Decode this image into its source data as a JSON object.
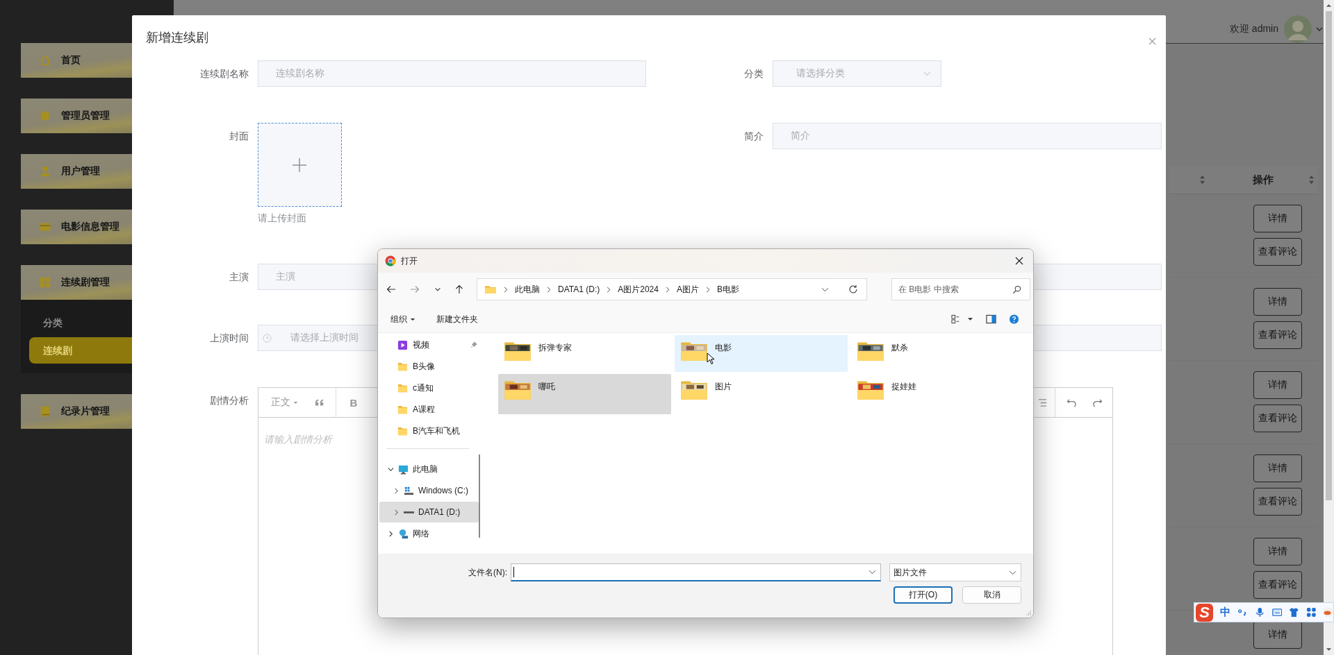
{
  "sidebar": {
    "items": [
      {
        "label": "首页"
      },
      {
        "label": "管理员管理"
      },
      {
        "label": "用户管理"
      },
      {
        "label": "电影信息管理"
      },
      {
        "label": "连续剧管理",
        "children": [
          {
            "label": "分类",
            "selected": false
          },
          {
            "label": "连续剧",
            "selected": true
          }
        ]
      },
      {
        "label": "纪录片管理"
      }
    ]
  },
  "header": {
    "greeting": "欢迎 admin"
  },
  "table": {
    "action_column": "操作",
    "rows": [
      {
        "actions": [
          "详情",
          "查看评论"
        ]
      },
      {
        "actions": [
          "详情",
          "查看评论"
        ]
      },
      {
        "actions": [
          "详情",
          "查看评论"
        ]
      },
      {
        "actions": [
          "详情",
          "查看评论"
        ]
      },
      {
        "actions": [
          "详情",
          "查看评论"
        ]
      },
      {
        "actions": [
          "详情"
        ]
      }
    ]
  },
  "modal": {
    "title": "新增连续剧",
    "rows": [
      {
        "left": {
          "kind": "text",
          "label": "连续剧名称",
          "placeholder": "连续剧名称"
        },
        "right": {
          "kind": "select",
          "label": "分类",
          "placeholder": "请选择分类"
        }
      },
      {
        "left": {
          "kind": "upload",
          "label": "封面",
          "hint": "请上传封面"
        },
        "right": {
          "kind": "text",
          "label": "简介",
          "placeholder": "简介"
        }
      },
      {
        "left": {
          "kind": "text",
          "label": "主演",
          "placeholder": "主演"
        },
        "right": {
          "kind": "text"
        }
      },
      {
        "left": {
          "kind": "date",
          "label": "上演时间",
          "placeholder": "请选择上演时间"
        },
        "right": {
          "kind": "text"
        }
      }
    ],
    "editor": {
      "label": "剧情分析",
      "format": "正文",
      "bold": "B",
      "placeholder": "请输入剧情分析"
    }
  },
  "dialog": {
    "title": "打开",
    "path": [
      "此电脑",
      "DATA1 (D:)",
      "A图片2024",
      "A图片",
      "B电影"
    ],
    "search_placeholder": "在 B电影 中搜索",
    "commands": [
      "组织",
      "新建文件夹"
    ],
    "quick": [
      {
        "label": "视频",
        "kind": "video",
        "pinned": true,
        "selected": false
      },
      {
        "label": "B头像",
        "kind": "folder",
        "pinned": false,
        "selected": false
      },
      {
        "label": "c通知",
        "kind": "folder",
        "pinned": false,
        "selected": false
      },
      {
        "label": "A课程",
        "kind": "folder",
        "pinned": false,
        "selected": false
      },
      {
        "label": "B汽车和飞机",
        "kind": "folder",
        "pinned": false,
        "selected": false
      }
    ],
    "tree": [
      {
        "label": "此电脑",
        "kind": "pc",
        "expanded": true,
        "selected": false,
        "children": [
          {
            "label": "Windows (C:)",
            "kind": "windows-drive",
            "expanded": false,
            "selected": false
          },
          {
            "label": "DATA1 (D:)",
            "kind": "drive",
            "expanded": false,
            "selected": true
          }
        ]
      },
      {
        "label": "网络",
        "kind": "network",
        "expanded": false,
        "selected": false
      }
    ],
    "files": [
      {
        "name": "拆弹专家",
        "selected": false,
        "hovered": false
      },
      {
        "name": "电影",
        "selected": false,
        "hovered": true
      },
      {
        "name": "默杀",
        "selected": false,
        "hovered": false
      },
      {
        "name": "哪吒",
        "selected": true,
        "hovered": false
      },
      {
        "name": "图片",
        "selected": false,
        "hovered": false
      },
      {
        "name": "捉娃娃",
        "selected": false,
        "hovered": false
      }
    ],
    "filename_label": "文件名(N):",
    "filetype": "图片文件",
    "buttons": [
      {
        "label": "打开(O)",
        "default": true
      },
      {
        "label": "取消",
        "default": false
      }
    ]
  },
  "ime": {
    "logo": "S",
    "mode": "中"
  }
}
